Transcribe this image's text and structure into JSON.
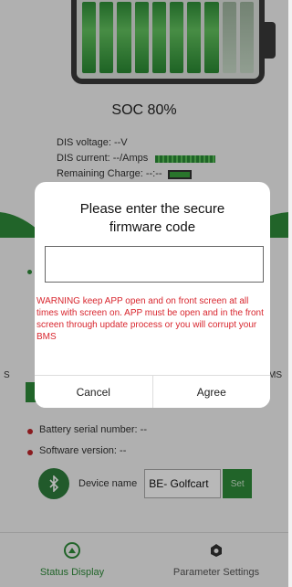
{
  "soc_label": "SOC 80%",
  "soc_percent": 80,
  "battery": {
    "cells_total": 10,
    "cells_on": 8
  },
  "info": {
    "dis_voltage": "DIS voltage:  --V",
    "dis_current": "DIS current:  --/Amps",
    "remaining_charge": "Remaining Charge:  --:--"
  },
  "dialog": {
    "title": "Please enter the secure firmware code",
    "input_value": "",
    "warning": "WARNING keep APP open and on front screen at all times with screen on. APP must be open and in the front screen through update process or you will corrupt your BMS",
    "cancel_label": "Cancel",
    "agree_label": "Agree"
  },
  "side_fragments": {
    "left": "S",
    "right": "MS"
  },
  "lower": {
    "serial": "Battery serial number:  --",
    "software": "Software version:  --",
    "device_label": "Device name",
    "device_value": "BE- Golfcart",
    "set_label": "Set"
  },
  "nav": {
    "status": "Status Display",
    "params": "Parameter Settings"
  },
  "colors": {
    "accent": "#2e8b3a",
    "warning": "#d8262e"
  },
  "icons": {
    "status": "status-display-icon",
    "params": "parameter-settings-icon",
    "bluetooth": "bluetooth-icon"
  }
}
